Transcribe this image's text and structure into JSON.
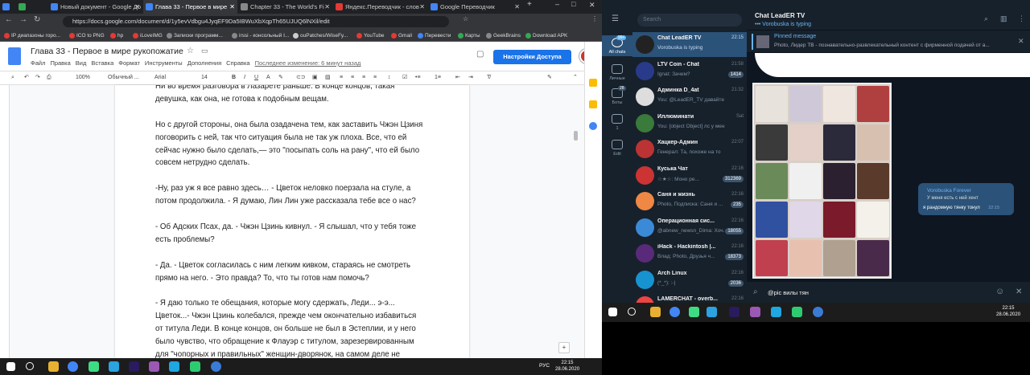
{
  "browser": {
    "tabs": [
      {
        "label": "",
        "color": "#4285f4"
      },
      {
        "label": "",
        "color": "#34a853"
      },
      {
        "label": "Новый документ - Google До",
        "color": "#4285f4"
      },
      {
        "label": "Глава 33 - Первое в мире ",
        "color": "#4285f4"
      },
      {
        "label": "Chapter 33 - The World's Fi",
        "color": "#888"
      },
      {
        "label": "Яндекс.Переводчик - слов",
        "color": "#e53935"
      },
      {
        "label": "Google Переводчик",
        "color": "#4285f4"
      }
    ],
    "url": "https://docs.google.com/document/d/1y5evVdbgu4JyqEF9Da5IBWuXbXqpTh65UJUQ6lNXil/edit",
    "bookmarks": [
      {
        "label": "IP диапазоны горо...",
        "color": "#e53935"
      },
      {
        "label": "ICO to PNG",
        "color": "#e53935"
      },
      {
        "label": "hp",
        "color": "#e53935"
      },
      {
        "label": "iLoveIMG",
        "color": "#e53935"
      },
      {
        "label": "Записки программ...",
        "color": "#888"
      },
      {
        "label": "irssi - консольный I...",
        "color": "#888"
      },
      {
        "label": "ouPatches/WiseFy...",
        "color": "#ccc"
      },
      {
        "label": "YouTube",
        "color": "#e53935"
      },
      {
        "label": "Gmail",
        "color": "#e53935"
      },
      {
        "label": "Перевести",
        "color": "#4285f4"
      },
      {
        "label": "Карты",
        "color": "#34a853"
      },
      {
        "label": "GeekBrains",
        "color": "#888"
      },
      {
        "label": "Download APK",
        "color": "#34a853"
      }
    ]
  },
  "doc": {
    "title": "Глава 33 - Первое в мире рукопожатие",
    "menu": [
      "Файл",
      "Правка",
      "Вид",
      "Вставка",
      "Формат",
      "Инструменты",
      "Дополнения",
      "Справка"
    ],
    "last_edit": "Последнее изменение: 6 минут назад",
    "share": "Настройки Доступа",
    "toolbar": {
      "zoom": "100%",
      "style": "Обычный ...",
      "font": "Arial",
      "size": "14"
    },
    "paragraphs": [
      "Ни во время разговора в Лазарете раньше. В конце концов, такая девушка, как она, не готова к подобным вещам.",
      "Но с другой стороны, она была озадачена тем, как заставить Чжэн Цзиня поговорить с ней, так что ситуация была не так уж плоха. Все, что ей сейчас нужно было сделать,— это \"посыпать соль на рану\", что ей было совсем нетрудно сделать.",
      "-Ну, раз уж я все равно здесь… - Цветок неловко поерзала на стуле, а потом продолжила. - Я думаю, Лин Лин уже рассказала тебе все о нас?",
      "- Об Адских Псах, да. - Чжэн Цзинь кивнул. - Я слышал, что у тебя тоже есть проблемы?",
      "- Да. - Цветок согласилась с ним легким кивком, стараясь не смотреть прямо на него. - Это правда? То, что ты готов нам помочь?",
      "- Я даю только те обещания, которые могу сдержать, Леди... э-э... Цветок...- Чжэн Цзинь колебался, прежде чем окончательно избавиться от титула Леди. В конце концов, он больше не был в Эстеплии, и у него было чувство, что обращение к Флауэр с титулом, зарезервированным для \"чопорных и правильных\" женщин-дворянок, на самом деле не так...подходящий."
    ]
  },
  "taskbar_left": {
    "lang": "РУС",
    "time": "22:15",
    "date": "28.06.2020"
  },
  "telegram": {
    "search_placeholder": "Search",
    "nav": [
      {
        "label": "All chats",
        "badge": "99+"
      },
      {
        "label": "Личные",
        "badge": ""
      },
      {
        "label": "Боты",
        "badge": "28"
      },
      {
        "label": "1",
        "badge": ""
      },
      {
        "label": "Edit",
        "badge": ""
      }
    ],
    "chats": [
      {
        "name": "Chat LeadER TV",
        "preview": "Vorobuska is typing",
        "time": "22:15",
        "badge": "",
        "color": "#222"
      },
      {
        "name": "LTV Coin - Chat",
        "preview": "Ignat: Зачем?",
        "time": "21:58",
        "badge": "1414",
        "color": "#2a3a8a"
      },
      {
        "name": "Админка D_4at",
        "preview": "You: @LeadER_TV давайте ...",
        "time": "21:32",
        "badge": "",
        "color": "#ddd"
      },
      {
        "name": "Иллюминати",
        "preview": "You: [object Object] лс у меня",
        "time": "Sat",
        "badge": "",
        "color": "#3a7a3a"
      },
      {
        "name": "Хацкер-Админ",
        "preview": "Генерал: Та, похоже на то",
        "time": "22:07",
        "badge": "",
        "color": "#b33"
      },
      {
        "name": "Куська Чат",
        "preview": "☆★☆: Моно ре...",
        "time": "22:16",
        "badge": "312369",
        "color": "#c33"
      },
      {
        "name": "Саня и жизнь",
        "preview": "Photo, Подписка: Саня и ...",
        "time": "22:16",
        "badge": "235",
        "color": "#e84"
      },
      {
        "name": "Операционная сис...",
        "preview": "@abnew_newsn_Dima: Хоч...",
        "time": "22:16",
        "badge": "18055",
        "color": "#3a8ad8"
      },
      {
        "name": "iHack - Hackintosh |...",
        "preview": "Влад: Photo, Друзья ч...",
        "time": "22:16",
        "badge": "18373",
        "color": "#5a2a7a"
      },
      {
        "name": "Arch Linux",
        "preview": "(*_*): :-|",
        "time": "22:16",
        "badge": "2036",
        "color": "#1793d1"
      },
      {
        "name": "LAMERCHAT - overb...",
        "preview": "",
        "time": "22:16",
        "badge": "",
        "color": "#e44"
      }
    ],
    "header": {
      "name": "Chat LeadER TV",
      "status": "••• Vorobuska is typing"
    },
    "pinned": {
      "title": "Pinned message",
      "text": "Photo, Лидер ТВ - познавательно-развлекательный контент с фирменной подачей от а..."
    },
    "bubble": {
      "name": "Vorobuska Forever",
      "line1": "У меня есть с ней хент",
      "line2": "я рандомную тянку тонул",
      "time": "22:15"
    },
    "input": "@pic вилы тян"
  },
  "taskbar_right": {
    "time": "22:15",
    "date": "28.06.2020"
  }
}
